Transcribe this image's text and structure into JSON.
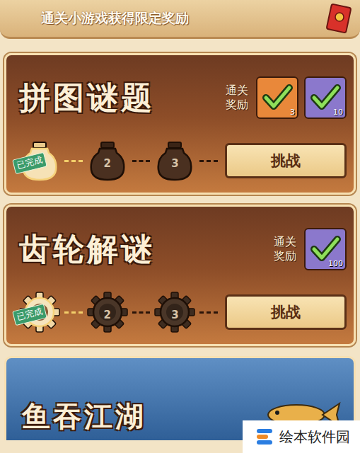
{
  "banner": {
    "title": "通关小游戏获得限定奖励"
  },
  "games": [
    {
      "title": "拼图谜题",
      "kind": "jar",
      "reward_label": "通关奖励",
      "rewards": [
        {
          "count": "3",
          "claimed": true,
          "color": "#e9883a"
        },
        {
          "count": "10",
          "claimed": true,
          "color": "#8b78cc"
        }
      ],
      "stages": [
        {
          "label": "已完成",
          "completed": true
        },
        {
          "label": "2",
          "completed": false
        },
        {
          "label": "3",
          "completed": false
        }
      ],
      "button": "挑战"
    },
    {
      "title": "齿轮解谜",
      "kind": "gear",
      "reward_label": "通关奖励",
      "rewards": [
        {
          "count": "100",
          "claimed": true,
          "color": "#8b78cc"
        }
      ],
      "stages": [
        {
          "label": "已完成",
          "completed": true
        },
        {
          "label": "2",
          "completed": false
        },
        {
          "label": "3",
          "completed": false
        }
      ],
      "button": "挑战"
    }
  ],
  "teaser": {
    "title": "鱼吞江湖"
  },
  "watermark": {
    "text": "绘本软件园"
  }
}
